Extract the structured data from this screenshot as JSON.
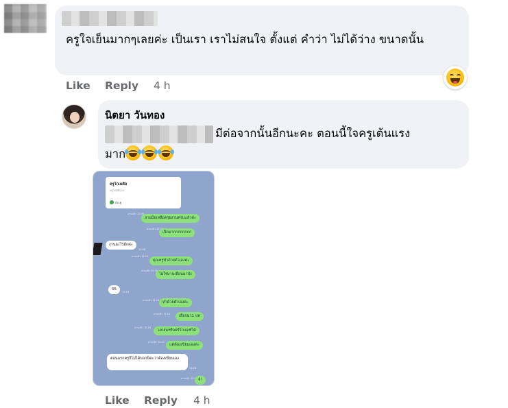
{
  "comment1": {
    "text": "ครูใจเย็นมากๆเลยค่ะ เป็นเรา เราไม่สนใจ ตั้งแต่ คำว่า ไม่ได้ว่าง ขนาดนั้น",
    "actions": {
      "like": "Like",
      "reply": "Reply",
      "time": "4 h"
    },
    "reaction_icon": "laughing-emoji-icon"
  },
  "comment2": {
    "author": "นิตยา วันทอง",
    "text_line1": "มีต่อจากนั้นอีกนะคะ ตอนนี้ใจครูเต้นแรง",
    "text_line2": "มาก",
    "emoji_count": 3,
    "emoji_icon": "rolling-on-floor-laughing-icon",
    "actions": {
      "like": "Like",
      "reply": "Reply",
      "time": "4 h"
    }
  },
  "chat_image": {
    "card_title": "ครูโกเมศิล",
    "card_subtitle": "ครูไทยฝันไป",
    "card_status": "ยังอยู่",
    "messages": [
      {
        "side": "right",
        "text": "ลายมือเหลือครุยงานครบแล้วค่ะ",
        "time": "อ่านแล้ว 12:05"
      },
      {
        "side": "right",
        "text": "เปิดมากกกกกกกก",
        "time": "อ่านแล้ว 12:06"
      },
      {
        "side": "left",
        "text": "งานอะไรอีกค่ะ",
        "time": "12:06"
      },
      {
        "side": "right",
        "text": "คุณครูทำด้วยตัวเองค่ะ",
        "time": "อ่านแล้ว 12:15"
      },
      {
        "side": "right",
        "text": "ไม่ใช่งานเพื่อนมาส่ง",
        "time": "อ่านแล้ว 12:16"
      },
      {
        "side": "left",
        "text": "55",
        "time": "12:16"
      },
      {
        "side": "right",
        "text": "ทำด้วยตัวเองค่ะ",
        "time": "อ่านแล้ว 12:16"
      },
      {
        "side": "right",
        "text": "เลือกมา1 บท",
        "time": "อ่านแล้ว 12:16"
      },
      {
        "side": "right",
        "text": "วงกลมหรือครีโกเณฑ์ได้",
        "time": "อ่านแล้ว 12:16"
      },
      {
        "side": "right",
        "text": "แต่ต้องเขียนเองค่ะ",
        "time": "อ่านแล้ว 12:17"
      },
      {
        "side": "left",
        "text": "ตอนแรกครูก็ไม่ได้บอกนิคะว่าต้องเขียนเอง",
        "time": "12:18"
      },
      {
        "side": "right",
        "text": "จ้า",
        "time": "อ่านแล้ว 12:18"
      }
    ]
  }
}
